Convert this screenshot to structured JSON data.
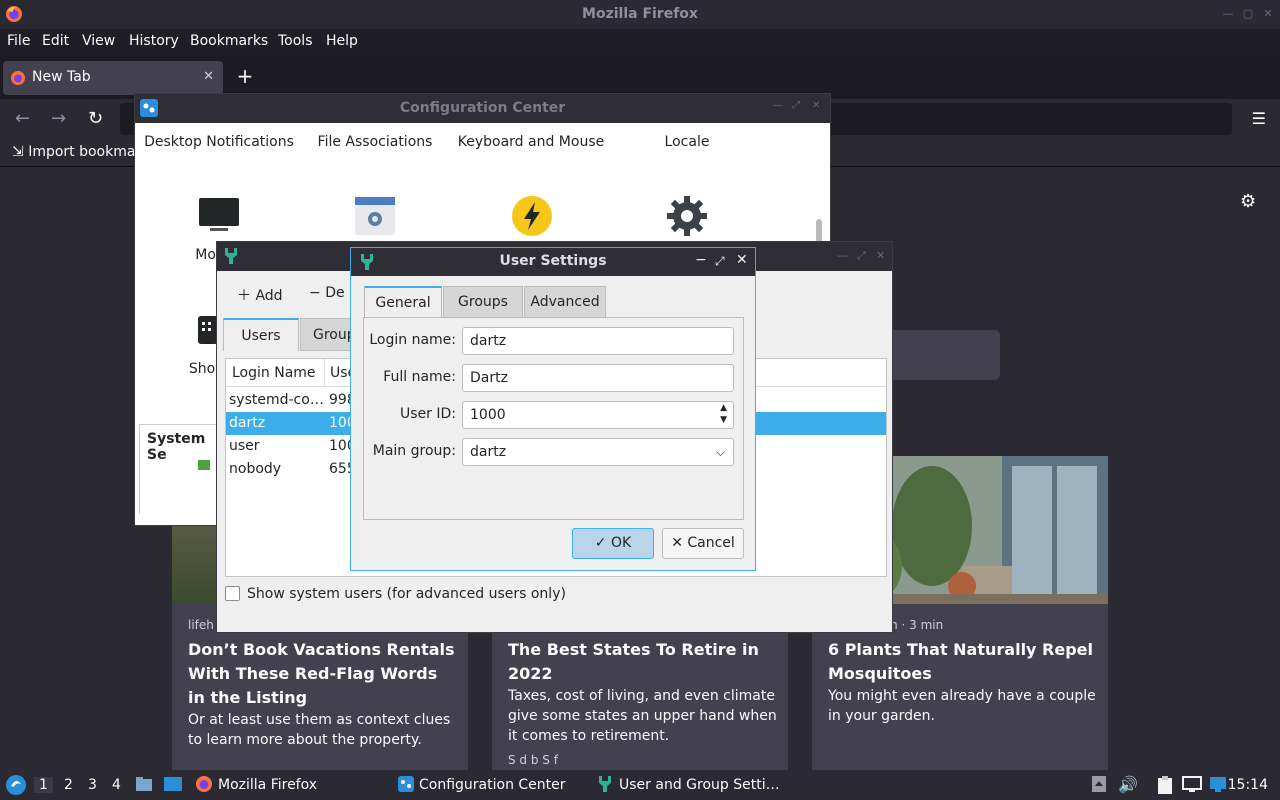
{
  "firefox": {
    "window_title": "Mozilla Firefox",
    "menu": [
      "File",
      "Edit",
      "View",
      "History",
      "Bookmarks",
      "Tools",
      "Help"
    ],
    "tab_label": "New Tab",
    "import_bookmarks": "Import bookma",
    "cards": [
      {
        "source": "lifeh",
        "title": "Don’t Book Vacations Rentals With These Red-Flag Words in the Listing",
        "desc": "Or at least use them as context clues to learn more about the property."
      },
      {
        "source": "",
        "title": "The Best States To Retire in 2022",
        "desc": "Taxes, cost of living, and even climate give some states an upper hand when it comes to retirement.",
        "sponsor": "S        d b  S     f  "
      },
      {
        "source": "herapy.com · 3 min",
        "title": "6 Plants That Naturally Repel Mosquitoes",
        "desc": "You might even already have a couple in your garden."
      }
    ]
  },
  "config_center": {
    "title": "Configuration Center",
    "items_row1": [
      "Desktop Notifications",
      "File Associations",
      "Keyboard and Mouse",
      "Locale"
    ],
    "items_row2": [
      "Monito",
      "",
      "",
      ""
    ],
    "items_row3": [
      "Shorto"
    ],
    "section_label": "System Se"
  },
  "user_group": {
    "toolbar": {
      "add": "Add",
      "delete": "De"
    },
    "tabs": [
      "Users",
      "Group"
    ],
    "columns": [
      "Login Name",
      "Use"
    ],
    "rows": [
      {
        "login": "systemd-co…",
        "uid": "998",
        "selected": false
      },
      {
        "login": "dartz",
        "uid": "100",
        "selected": true
      },
      {
        "login": "user",
        "uid": "100",
        "selected": false
      },
      {
        "login": "nobody",
        "uid": "655",
        "selected": false
      }
    ],
    "show_system": "Show system users (for advanced users only)"
  },
  "user_settings": {
    "title": "User Settings",
    "tabs": [
      "General",
      "Groups",
      "Advanced"
    ],
    "labels": {
      "login": "Login name:",
      "full": "Full name:",
      "uid": "User ID:",
      "group": "Main group:"
    },
    "values": {
      "login": "dartz",
      "full": "Dartz",
      "uid": "1000",
      "group": "dartz"
    },
    "ok": "OK",
    "cancel": "Cancel"
  },
  "taskbar": {
    "workspaces": [
      "1",
      "2",
      "3",
      "4"
    ],
    "tasks": [
      "Mozilla Firefox",
      "Configuration Center",
      "User and Group Setti…"
    ],
    "clock": "15:14"
  }
}
